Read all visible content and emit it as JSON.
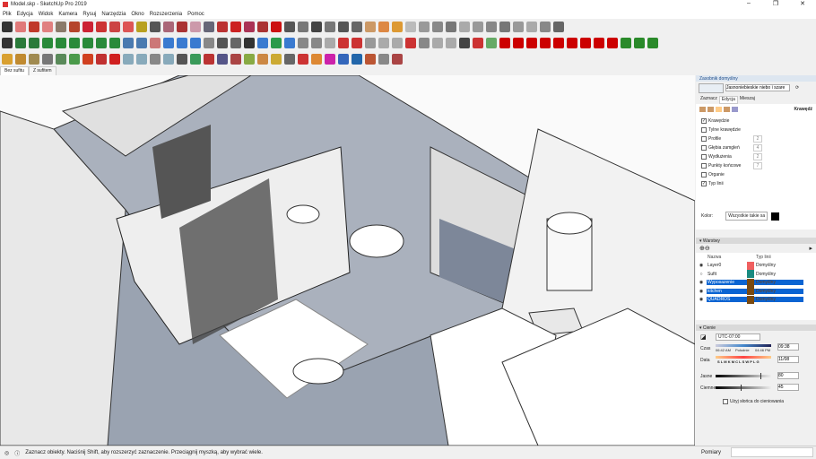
{
  "window": {
    "title": "Model.skp - SketchUp Pro 2019",
    "controls": [
      "–",
      "❐",
      "✕"
    ]
  },
  "menu": [
    "Plik",
    "Edycja",
    "Widok",
    "Kamera",
    "Rysuj",
    "Narzędzia",
    "Okno",
    "Rozszerzenia",
    "Pomoc"
  ],
  "toolbars": {
    "row1": [
      "#333",
      "#e07a7a",
      "#c0392b",
      "#e08080",
      "#8a7a6a",
      "#b5442b",
      "#c23",
      "#c33",
      "#c44",
      "#d55",
      "#b8a020",
      "#555",
      "#a67",
      "#a33",
      "#c9a",
      "#667",
      "#b33",
      "#c22",
      "#a35",
      "#a33",
      "#c11",
      "#555",
      "#777",
      "#444",
      "#777",
      "#555",
      "#666",
      "#c96",
      "#d84",
      "#d93",
      "#bbb",
      "#999",
      "#888",
      "#777",
      "#aaa",
      "#999",
      "#888",
      "#777",
      "#999",
      "#aaa",
      "#888",
      "#666"
    ],
    "row2": [
      "#333",
      "#2a7a3a",
      "#2a7a3a",
      "#2a8a3a",
      "#2a8a3a",
      "#2a8a3a",
      "#2a8a3a",
      "#2a8a3a",
      "#2a8a3a",
      "#4a7ab0",
      "#4a7ab0",
      "#c77",
      "#3a7ad0",
      "#3a7ad0",
      "#3a7ad0",
      "#888",
      "#555",
      "#666",
      "#333",
      "#3a7ad0",
      "#2a9a4a",
      "#3a7ad0",
      "#888",
      "#888",
      "#aaa",
      "#c33",
      "#c33",
      "#999",
      "#aaa",
      "#aaa",
      "#c33",
      "#888",
      "#aaa",
      "#aaa",
      "#444",
      "#c33",
      "#6a6",
      "#c00",
      "#c00",
      "#c00",
      "#c00",
      "#c00",
      "#c00",
      "#c00",
      "#c00",
      "#c00",
      "#2a8a2a",
      "#2a8a2a",
      "#2a8a2a"
    ],
    "row3": [
      "#d9a030",
      "#c08a30",
      "#a08a50",
      "#777",
      "#5a8a5a",
      "#4a9a4a",
      "#d04020",
      "#c03030",
      "#d02020",
      "#8ab",
      "#8ab",
      "#888",
      "#8ab",
      "#555",
      "#3a9a5a",
      "#b33",
      "#558",
      "#a44",
      "#8a4",
      "#c84",
      "#ca3",
      "#666",
      "#c33",
      "#d83",
      "#c2a",
      "#36b",
      "#26a",
      "#b53",
      "#888",
      "#a44"
    ]
  },
  "tabs": [
    "Bez sufitu",
    "Z sufitem"
  ],
  "panel": {
    "styles": {
      "title": "Zasobnik domyślny",
      "style_name": "Jasnoniebieskie niebo i szare",
      "tabs": [
        "Zaznacz",
        "Edycja",
        "Mieszaj"
      ],
      "section": "Krawędź",
      "options": [
        {
          "label": "Krawędzie",
          "checked": true
        },
        {
          "label": "Tylne krawędzie",
          "checked": false
        },
        {
          "label": "Profile",
          "checked": false,
          "value": "2"
        },
        {
          "label": "Głębia zamgleń",
          "checked": false,
          "value": "4"
        },
        {
          "label": "Wydłużenia",
          "checked": false,
          "value": "2"
        },
        {
          "label": "Punkty końcowe",
          "checked": false,
          "value": "7"
        },
        {
          "label": "Organie",
          "checked": false
        },
        {
          "label": "Typ linii",
          "checked": true
        }
      ],
      "color_label": "Kolor:",
      "color_value": "Wszystkie takie sa",
      "color_swatch": "#000000"
    },
    "layers": {
      "title": "Warstwy",
      "col_name": "Nazwa",
      "col_type": "Typ linii",
      "rows": [
        {
          "name": "Layer0",
          "color": "#f06060",
          "type": "Domyślny",
          "visible": true,
          "selected": false
        },
        {
          "name": "Sufit",
          "color": "#1a8a80",
          "type": "Domyślny",
          "visible": false,
          "selected": false
        },
        {
          "name": "Wyposazenie",
          "color": "#7a4a10",
          "type": "Domyślny",
          "visible": true,
          "selected": true
        },
        {
          "name": "kitchen",
          "color": "#7a4a10",
          "type": "Domyślny",
          "visible": true,
          "selected": true
        },
        {
          "name": "QUADROS",
          "color": "#7a4a10",
          "type": "Domyślny",
          "visible": true,
          "selected": true
        }
      ]
    },
    "shadows": {
      "title": "Cienie",
      "timezone": "UTC-07:00",
      "time_label": "Czas",
      "time_start": "06:42 AM",
      "time_mid": "Południe",
      "time_end": "04:46 PM",
      "time_value": "09:38",
      "date_label": "Data",
      "months": "S L M K M C L S W P L G",
      "date_value": "11/08",
      "light_label": "Jasne",
      "light_value": "80",
      "light_level": 0.8,
      "dark_label": "Ciemne",
      "dark_value": "45",
      "dark_level": 0.45,
      "use_sun_label": "Użyj słońca do cieniowania"
    },
    "measurements_label": "Pomiary"
  },
  "status": {
    "text": "Zaznacz obiekty. Naciśnij Shift, aby rozszerzyć zaznaczenie. Przeciągnij myszką, aby wybrać wiele."
  }
}
